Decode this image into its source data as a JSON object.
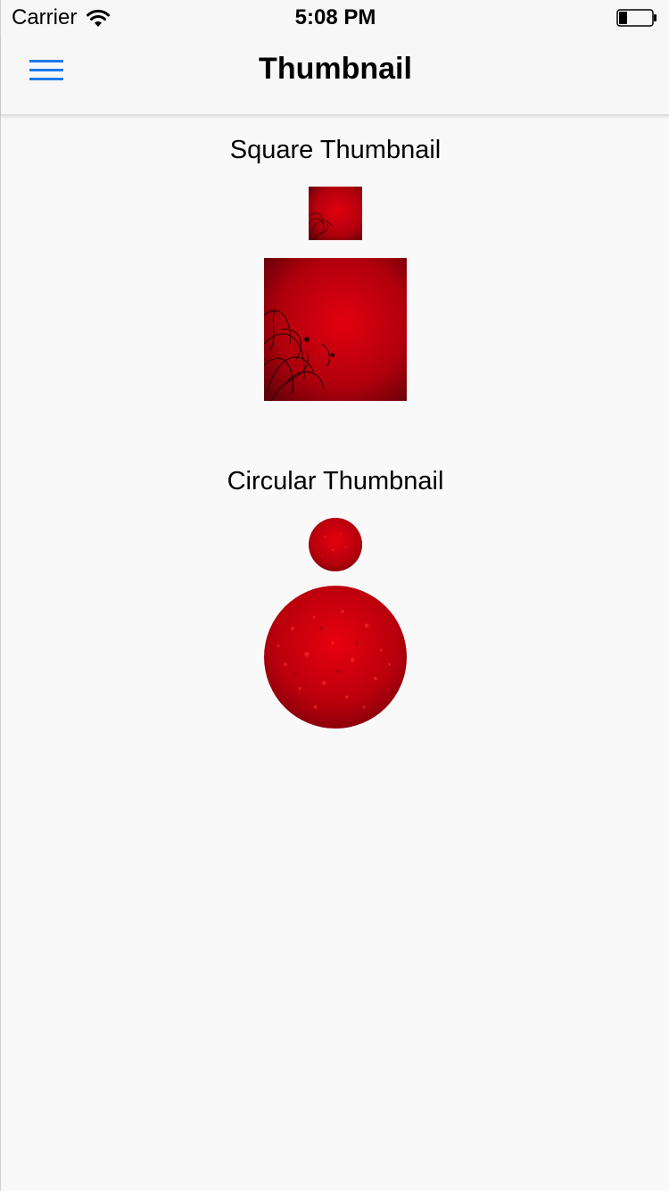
{
  "status_bar": {
    "carrier": "Carrier",
    "time": "5:08 PM"
  },
  "nav": {
    "title": "Thumbnail",
    "menu_icon": "hamburger-menu-icon",
    "accent_color": "#1a7ae8"
  },
  "sections": {
    "square": {
      "title": "Square Thumbnail"
    },
    "circular": {
      "title": "Circular Thumbnail"
    }
  },
  "colors": {
    "thumbnail_red": "#d6000f",
    "thumbnail_dark": "#5a0008"
  }
}
